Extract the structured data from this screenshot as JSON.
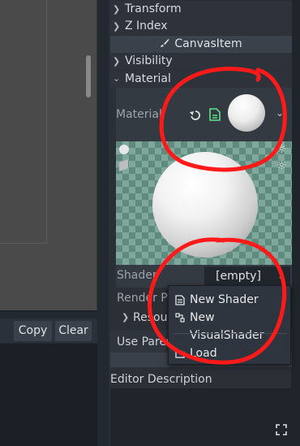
{
  "output_panel": {
    "copy_label": "Copy",
    "clear_label": "Clear"
  },
  "inspector": {
    "sections": [
      {
        "label": "Transform",
        "expanded": false
      },
      {
        "label": "Z Index",
        "expanded": false
      },
      {
        "label": "Visibility",
        "expanded": false
      },
      {
        "label": "Material",
        "expanded": true
      }
    ],
    "category": "CanvasItem",
    "material_label": "Material",
    "shader_label": "Shader",
    "shader_value": "[empty]",
    "render_priority_label": "Render Pr",
    "resource_label": "Resou",
    "use_parent_label": "Use Paren",
    "editor_description_label": "Editor Description"
  },
  "shader_menu": {
    "items": [
      {
        "label": "New Shader",
        "icon": "shader-icon"
      },
      {
        "label": "New VisualShader",
        "icon": "visual-shader-icon"
      },
      {
        "label": "Load",
        "icon": "folder-icon"
      }
    ]
  },
  "colors": {
    "annotation": "#ff1a1a",
    "accent_green": "#52c48a"
  }
}
